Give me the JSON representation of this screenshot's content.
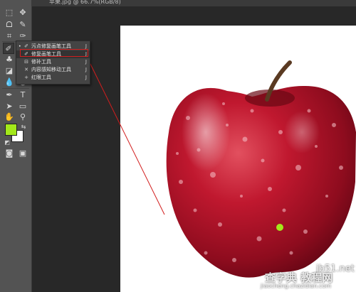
{
  "document": {
    "tab_title": "苹果.jpg @ 66.7%(RGB/8)"
  },
  "tools": {
    "items": [
      "marquee",
      "move",
      "lasso",
      "quick-select",
      "crop",
      "eyedropper",
      "healing-brush",
      "brush",
      "clone-stamp",
      "history-brush",
      "eraser",
      "gradient",
      "blur",
      "dodge",
      "pen",
      "type",
      "path-select",
      "shape",
      "hand",
      "zoom"
    ],
    "type_glyph": "T"
  },
  "colors": {
    "foreground": "#a3e81a",
    "background": "#ffffff",
    "accent_red": "#d21e1e"
  },
  "flyout": {
    "items": [
      {
        "label": "污点修复画笔工具",
        "key": "J",
        "icon": "spot-healing-brush-icon",
        "bullet": "•"
      },
      {
        "label": "修复画笔工具",
        "key": "J",
        "icon": "healing-brush-icon",
        "bullet": ""
      },
      {
        "label": "修补工具",
        "key": "J",
        "icon": "patch-icon",
        "bullet": ""
      },
      {
        "label": "内容感知移动工具",
        "key": "J",
        "icon": "content-aware-move-icon",
        "bullet": ""
      },
      {
        "label": "红眼工具",
        "key": "J",
        "icon": "red-eye-icon",
        "bullet": ""
      }
    ]
  },
  "watermark": {
    "site": "jb51.net",
    "cn_text": "查字典 教程网",
    "url": "jiaocheng.chazidian.com"
  }
}
